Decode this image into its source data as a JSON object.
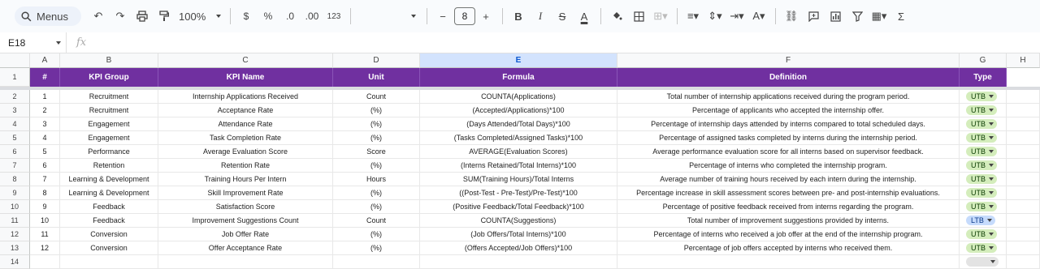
{
  "toolbar": {
    "menus_label": "Menus",
    "zoom": "100%",
    "currency": "$",
    "percent": "%",
    "dec_decrease": ".0",
    "dec_increase": ".00",
    "number_format": "123",
    "font_size": "8"
  },
  "formula_bar": {
    "cell_ref": "E18",
    "fx_label": "fx"
  },
  "columns": [
    "A",
    "B",
    "C",
    "D",
    "E",
    "F",
    "G",
    "H"
  ],
  "header": [
    "#",
    "KPI Group",
    "KPI Name",
    "Unit",
    "Formula",
    "Definition",
    "Type"
  ],
  "rows": [
    {
      "n": "1",
      "group": "Recruitment",
      "name": "Internship Applications Received",
      "unit": "Count",
      "formula": "COUNTA(Applications)",
      "definition": "Total number of internship applications received during the program period.",
      "type": "UTB"
    },
    {
      "n": "2",
      "group": "Recruitment",
      "name": "Acceptance Rate",
      "unit": "(%)",
      "formula": "(Accepted/Applications)*100",
      "definition": "Percentage of applicants who accepted the internship offer.",
      "type": "UTB"
    },
    {
      "n": "3",
      "group": "Engagement",
      "name": "Attendance Rate",
      "unit": "(%)",
      "formula": "(Days Attended/Total Days)*100",
      "definition": "Percentage of internship days attended by interns compared to total scheduled days.",
      "type": "UTB"
    },
    {
      "n": "4",
      "group": "Engagement",
      "name": "Task Completion Rate",
      "unit": "(%)",
      "formula": "(Tasks Completed/Assigned Tasks)*100",
      "definition": "Percentage of assigned tasks completed by interns during the internship period.",
      "type": "UTB"
    },
    {
      "n": "5",
      "group": "Performance",
      "name": "Average Evaluation Score",
      "unit": "Score",
      "formula": "AVERAGE(Evaluation Scores)",
      "definition": "Average performance evaluation score for all interns based on supervisor feedback.",
      "type": "UTB"
    },
    {
      "n": "6",
      "group": "Retention",
      "name": "Retention Rate",
      "unit": "(%)",
      "formula": "(Interns Retained/Total Interns)*100",
      "definition": "Percentage of interns who completed the internship program.",
      "type": "UTB"
    },
    {
      "n": "7",
      "group": "Learning & Development",
      "name": "Training Hours Per Intern",
      "unit": "Hours",
      "formula": "SUM(Training Hours)/Total Interns",
      "definition": "Average number of training hours received by each intern during the internship.",
      "type": "UTB"
    },
    {
      "n": "8",
      "group": "Learning & Development",
      "name": "Skill Improvement Rate",
      "unit": "(%)",
      "formula": "((Post-Test - Pre-Test)/Pre-Test)*100",
      "definition": "Percentage increase in skill assessment scores between pre- and post-internship evaluations.",
      "type": "UTB"
    },
    {
      "n": "9",
      "group": "Feedback",
      "name": "Satisfaction Score",
      "unit": "(%)",
      "formula": "(Positive Feedback/Total Feedback)*100",
      "definition": "Percentage of positive feedback received from interns regarding the program.",
      "type": "UTB"
    },
    {
      "n": "10",
      "group": "Feedback",
      "name": "Improvement Suggestions Count",
      "unit": "Count",
      "formula": "COUNTA(Suggestions)",
      "definition": "Total number of improvement suggestions provided by interns.",
      "type": "LTB"
    },
    {
      "n": "11",
      "group": "Conversion",
      "name": "Job Offer Rate",
      "unit": "(%)",
      "formula": "(Job Offers/Total Interns)*100",
      "definition": "Percentage of interns who received a job offer at the end of the internship program.",
      "type": "UTB"
    },
    {
      "n": "12",
      "group": "Conversion",
      "name": "Offer Acceptance Rate",
      "unit": "(%)",
      "formula": "(Offers Accepted/Job Offers)*100",
      "definition": "Percentage of job offers accepted by interns who received them.",
      "type": "UTB"
    }
  ],
  "row_numbers": [
    "1",
    "2",
    "3",
    "4",
    "5",
    "6",
    "7",
    "8",
    "9",
    "10",
    "11",
    "12",
    "13",
    "14"
  ],
  "colors": {
    "header_bg": "#7030a0",
    "utb_chip": "#d4edbc",
    "ltb_chip": "#c6dbfc",
    "selected_col": "#d3e3fd"
  }
}
